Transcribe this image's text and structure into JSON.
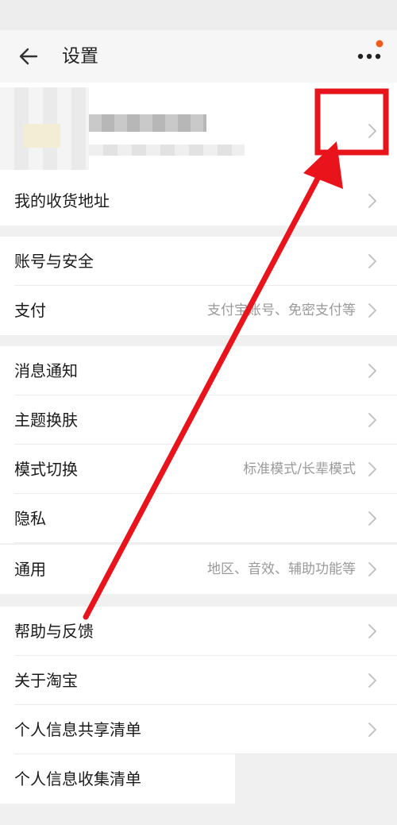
{
  "nav": {
    "title": "设置"
  },
  "rows": {
    "address": {
      "label": "我的收货地址"
    },
    "account": {
      "label": "账号与安全"
    },
    "payment": {
      "label": "支付",
      "value": "支付宝账号、免密支付等"
    },
    "notify": {
      "label": "消息通知"
    },
    "theme": {
      "label": "主题换肤"
    },
    "mode": {
      "label": "模式切换",
      "value": "标准模式/长辈模式"
    },
    "privacy": {
      "label": "隐私"
    },
    "general": {
      "label": "通用",
      "value": "地区、音效、辅助功能等"
    },
    "help": {
      "label": "帮助与反馈"
    },
    "about": {
      "label": "关于淘宝"
    },
    "share": {
      "label": "个人信息共享清单"
    },
    "collect": {
      "label": "个人信息收集清单"
    }
  },
  "icons": [
    "back-arrow-icon",
    "more-icon",
    "notification-dot-icon",
    "chevron-right-icon"
  ],
  "colors": {
    "annotation": "#e8131b",
    "notification_dot": "#f05a1a"
  }
}
